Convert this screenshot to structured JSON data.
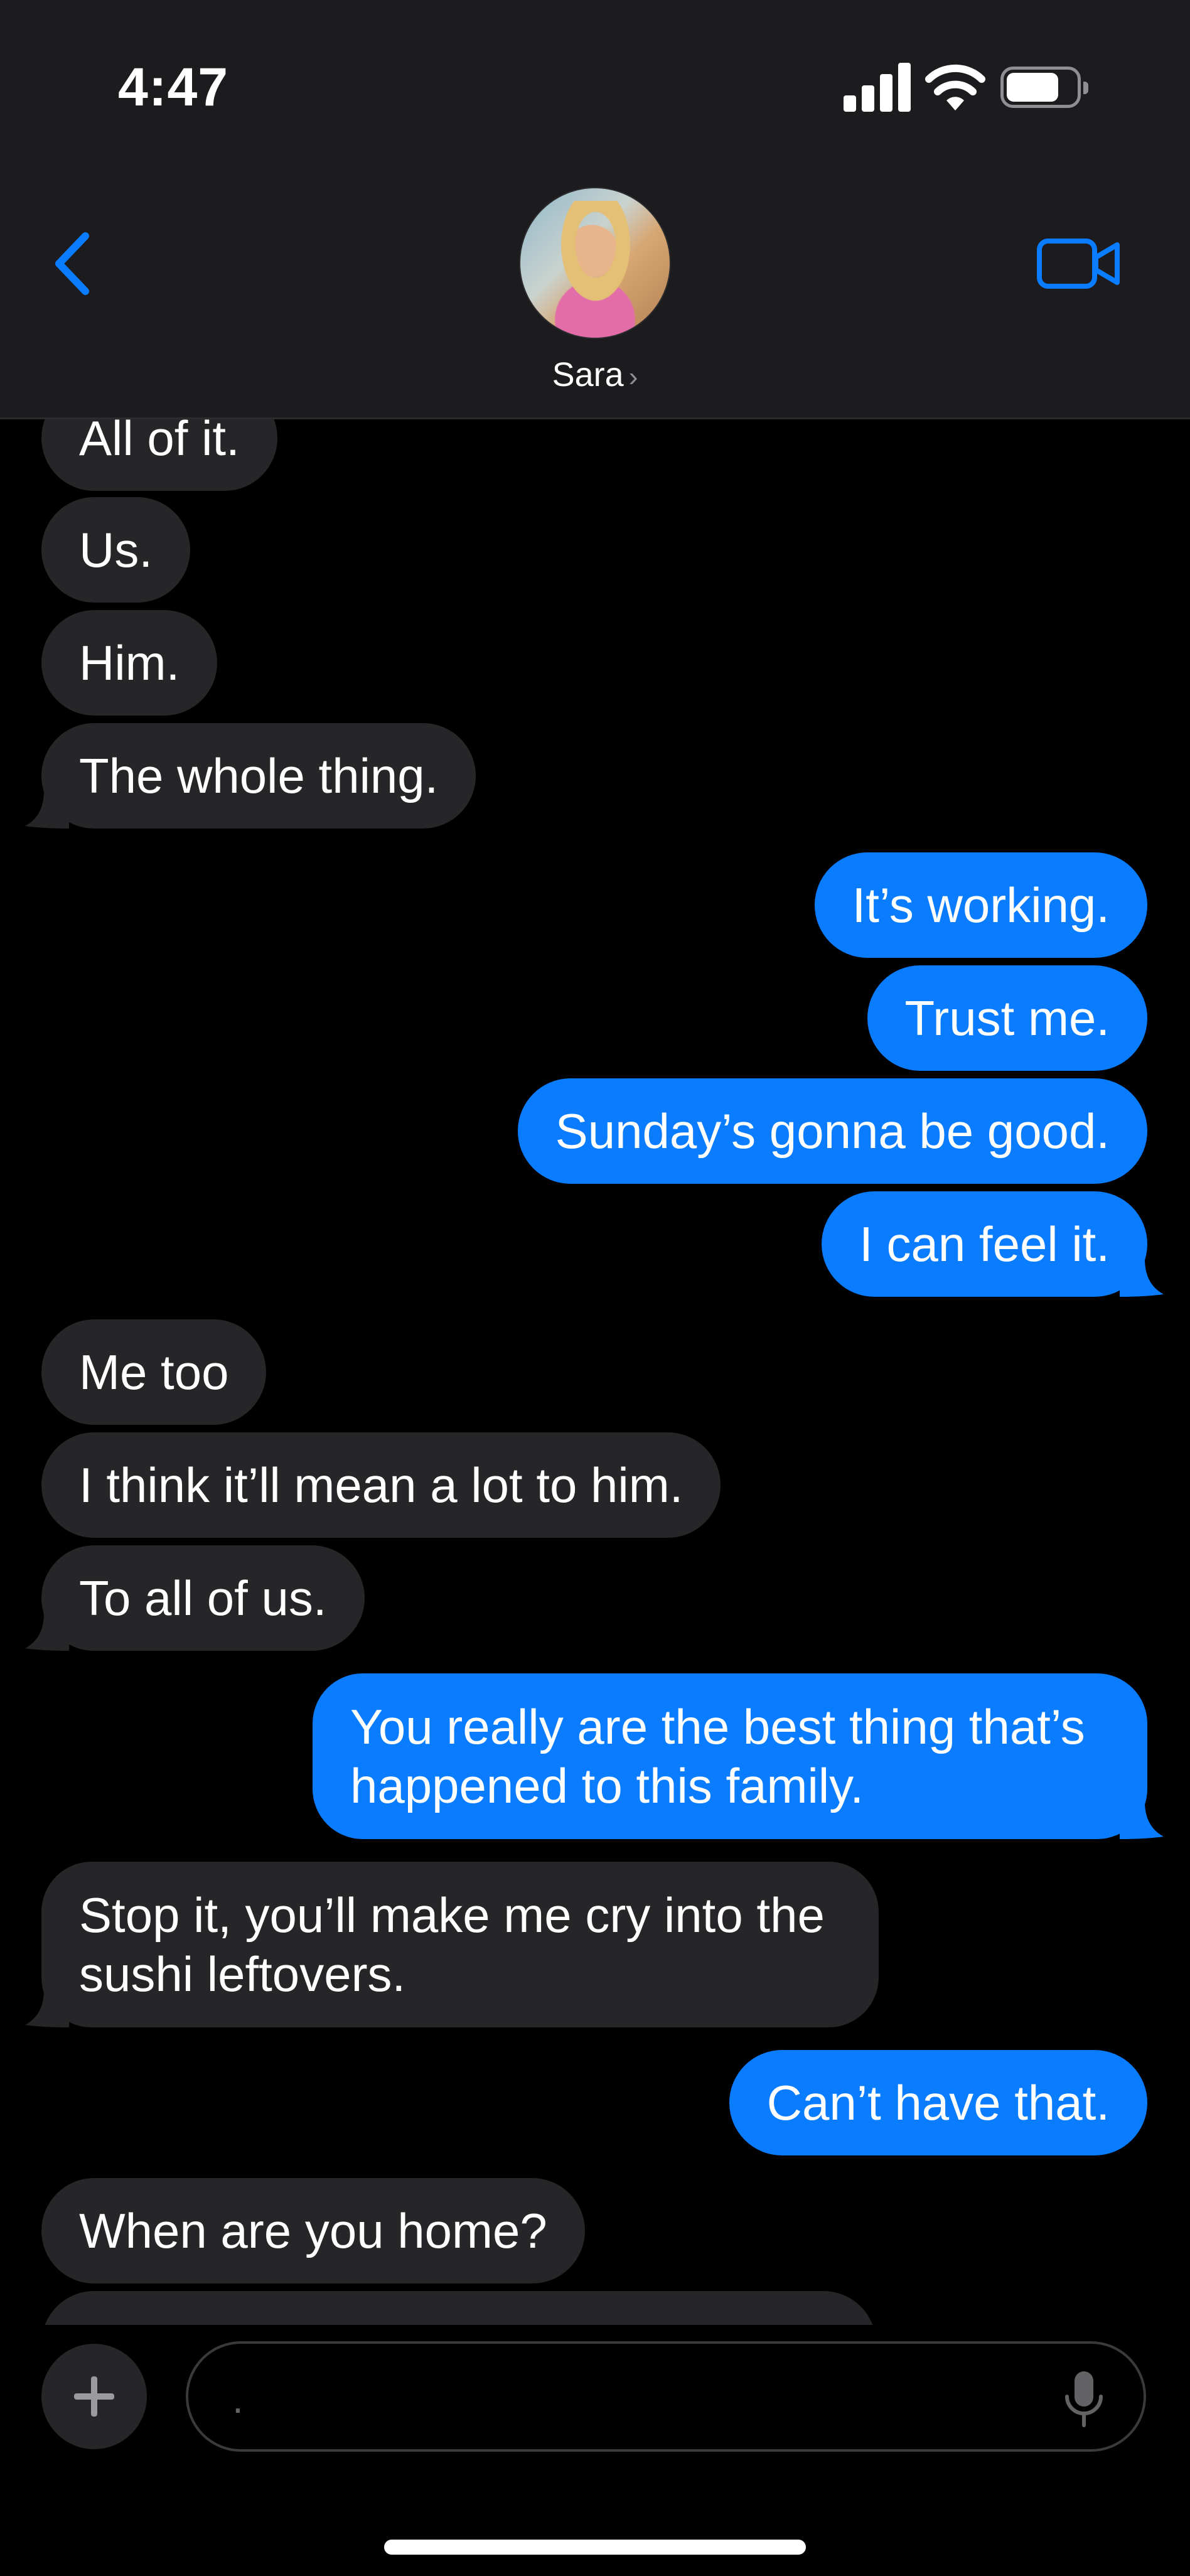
{
  "status_bar": {
    "time": "4:47"
  },
  "header": {
    "contact_name": "Sara",
    "contact_chevron": "›",
    "back_icon": "chevron-left-icon",
    "video_icon": "video-camera-icon",
    "accent_color": "#0a7cff"
  },
  "messages": [
    {
      "direction": "incoming",
      "text": "All of it."
    },
    {
      "direction": "incoming",
      "text": "Us."
    },
    {
      "direction": "incoming",
      "text": "Him."
    },
    {
      "direction": "incoming",
      "text": "The whole thing."
    },
    {
      "direction": "outgoing",
      "text": "It’s working."
    },
    {
      "direction": "outgoing",
      "text": "Trust me."
    },
    {
      "direction": "outgoing",
      "text": "Sunday’s gonna be good."
    },
    {
      "direction": "outgoing",
      "text": "I can feel it."
    },
    {
      "direction": "incoming",
      "text": "Me too"
    },
    {
      "direction": "incoming",
      "text": "I think it’ll mean a lot to him."
    },
    {
      "direction": "incoming",
      "text": "To all of us."
    },
    {
      "direction": "outgoing",
      "text": "You really are the best thing that’s happened to this family."
    },
    {
      "direction": "incoming",
      "text": "Stop it, you’ll make me cry into the sushi leftovers."
    },
    {
      "direction": "outgoing",
      "text": "Can’t have that."
    },
    {
      "direction": "incoming",
      "text": "When are you home?"
    }
  ],
  "input_bar": {
    "placeholder": ".",
    "value": "",
    "plus_icon": "plus-icon",
    "mic_icon": "microphone-icon"
  },
  "colors": {
    "incoming_bubble": "#262628",
    "outgoing_bubble": "#0a7cff",
    "header_bg": "#1c1c1e"
  }
}
